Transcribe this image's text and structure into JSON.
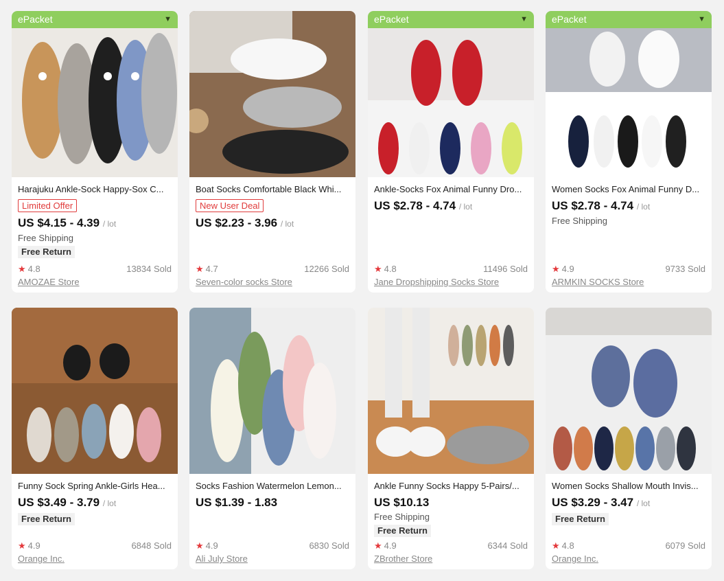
{
  "products": [
    {
      "badge": "ePacket",
      "title": "Harajuku Ankle-Sock Happy-Sox C...",
      "tag": "Limited Offer",
      "price": "US $4.15 - 4.39",
      "unit": "/ lot",
      "shipping": "Free Shipping",
      "free_return": "Free Return",
      "rating": "4.8",
      "sold": "13834 Sold",
      "store": "AMOZAE Store",
      "image_icon": "cat-socks-photo"
    },
    {
      "badge": "",
      "title": "Boat Socks Comfortable Black Whi...",
      "tag": "New User Deal",
      "price": "US $2.23 - 3.96",
      "unit": "/ lot",
      "shipping": "",
      "free_return": "",
      "rating": "4.7",
      "sold": "12266 Sold",
      "store": "Seven-color socks Store",
      "image_icon": "plain-socks-photo"
    },
    {
      "badge": "ePacket",
      "title": "Ankle-Socks Fox Animal Funny Dro...",
      "tag": "",
      "price": "US $2.78 - 4.74",
      "unit": "/ lot",
      "shipping": "",
      "free_return": "",
      "rating": "4.8",
      "sold": "11496 Sold",
      "store": "Jane Dropshipping Socks Store",
      "image_icon": "cartoon-socks-photo"
    },
    {
      "badge": "ePacket",
      "title": "Women Socks Fox Animal Funny D...",
      "tag": "",
      "price": "US $2.78 - 4.74",
      "unit": "/ lot",
      "shipping": "Free Shipping",
      "free_return": "",
      "rating": "4.9",
      "sold": "9733 Sold",
      "store": "ARMKIN SOCKS Store",
      "image_icon": "cartoon-socks-photo"
    },
    {
      "badge": "",
      "title": "Funny Sock Spring Ankle-Girls Hea...",
      "tag": "",
      "price": "US $3.49 - 3.79",
      "unit": "/ lot",
      "shipping": "",
      "free_return": "Free Return",
      "rating": "4.9",
      "sold": "6848 Sold",
      "store": "Orange Inc.",
      "image_icon": "heart-socks-photo"
    },
    {
      "badge": "",
      "title": "Socks Fashion Watermelon Lemon...",
      "tag": "",
      "price": "US $1.39 - 1.83",
      "unit": "",
      "shipping": "",
      "free_return": "",
      "rating": "4.9",
      "sold": "6830 Sold",
      "store": "Ali July Store",
      "image_icon": "fruit-socks-photo"
    },
    {
      "badge": "",
      "title": "Ankle Funny Socks Happy 5-Pairs/...",
      "tag": "",
      "price": "US $10.13",
      "unit": "",
      "shipping": "Free Shipping",
      "free_return": "Free Return",
      "rating": "4.9",
      "sold": "6344 Sold",
      "store": "ZBrother Store",
      "image_icon": "colorful-socks-photo"
    },
    {
      "badge": "",
      "title": "Women Socks Shallow Mouth Invis...",
      "tag": "",
      "price": "US $3.29 - 3.47",
      "unit": "/ lot",
      "shipping": "",
      "free_return": "Free Return",
      "rating": "4.8",
      "sold": "6079 Sold",
      "store": "Orange Inc.",
      "image_icon": "invisible-socks-photo"
    }
  ],
  "colors": {
    "badge": "#8fce5e",
    "tag": "#e03b3b",
    "star": "#e4393c"
  }
}
